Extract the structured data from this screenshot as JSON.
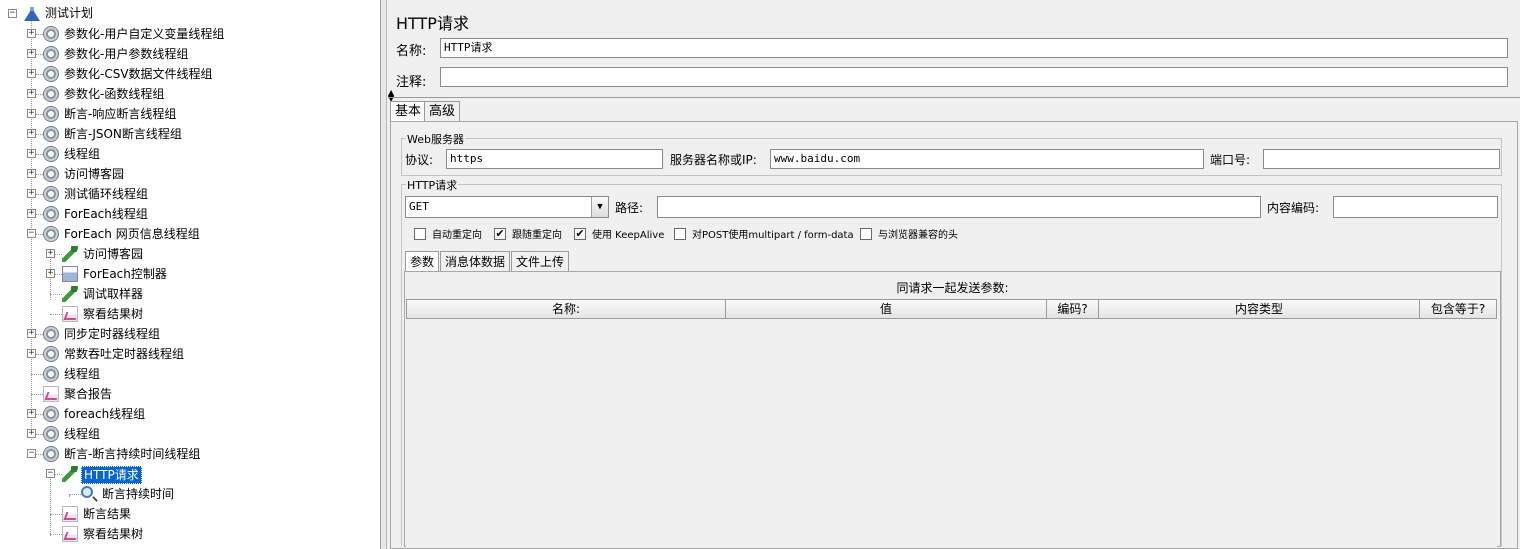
{
  "tree": {
    "root_label": "测试计划",
    "items": [
      {
        "label": "参数化-用户自定义变量线程组"
      },
      {
        "label": "参数化-用户参数线程组"
      },
      {
        "label": "参数化-CSV数据文件线程组"
      },
      {
        "label": "参数化-函数线程组"
      },
      {
        "label": "断言-响应断言线程组"
      },
      {
        "label": "断言-JSON断言线程组"
      },
      {
        "label": "线程组"
      },
      {
        "label": "访问博客园"
      },
      {
        "label": "测试循环线程组"
      },
      {
        "label": "ForEach线程组"
      },
      {
        "label": "ForEach 网页信息线程组"
      },
      {
        "label": "访问博客园"
      },
      {
        "label": "ForEach控制器"
      },
      {
        "label": "调试取样器"
      },
      {
        "label": "察看结果树"
      },
      {
        "label": "同步定时器线程组"
      },
      {
        "label": "常数吞吐定时器线程组"
      },
      {
        "label": "线程组"
      },
      {
        "label": "聚合报告"
      },
      {
        "label": "foreach线程组"
      },
      {
        "label": "线程组"
      },
      {
        "label": "断言-断言持续时间线程组"
      },
      {
        "label": "HTTP请求"
      },
      {
        "label": "断言持续时间"
      },
      {
        "label": "断言结果"
      },
      {
        "label": "察看结果树"
      }
    ],
    "selected_item": "HTTP请求"
  },
  "panel": {
    "title": "HTTP请求",
    "name_label": "名称:",
    "name_value": "HTTP请求",
    "comment_label": "注释:",
    "comment_value": "",
    "tabs": [
      "基本",
      "高级"
    ],
    "active_tab": "基本"
  },
  "web_server": {
    "group_title": "Web服务器",
    "protocol_label": "协议:",
    "protocol_value": "https",
    "server_label": "服务器名称或IP:",
    "server_value": "www.baidu.com",
    "port_label": "端口号:",
    "port_value": ""
  },
  "http_request": {
    "group_title": "HTTP请求",
    "method": "GET",
    "path_label": "路径:",
    "path_value": "",
    "encoding_label": "内容编码:",
    "encoding_value": "",
    "checkboxes": [
      {
        "label": "自动重定向",
        "checked": false
      },
      {
        "label": "跟随重定向",
        "checked": true
      },
      {
        "label": "使用 KeepAlive",
        "checked": true
      },
      {
        "label": "对POST使用multipart / form-data",
        "checked": false
      },
      {
        "label": "与浏览器兼容的头",
        "checked": false
      }
    ],
    "check_mark": "✔",
    "sub_tabs": [
      "参数",
      "消息体数据",
      "文件上传"
    ],
    "active_sub_tab": "参数",
    "params_caption": "同请求一起发送参数:",
    "columns": [
      "名称:",
      "值",
      "编码?",
      "内容类型",
      "包含等于?"
    ]
  },
  "colors": {
    "selection": "#0a64d0",
    "background": "#f0f0f0"
  }
}
